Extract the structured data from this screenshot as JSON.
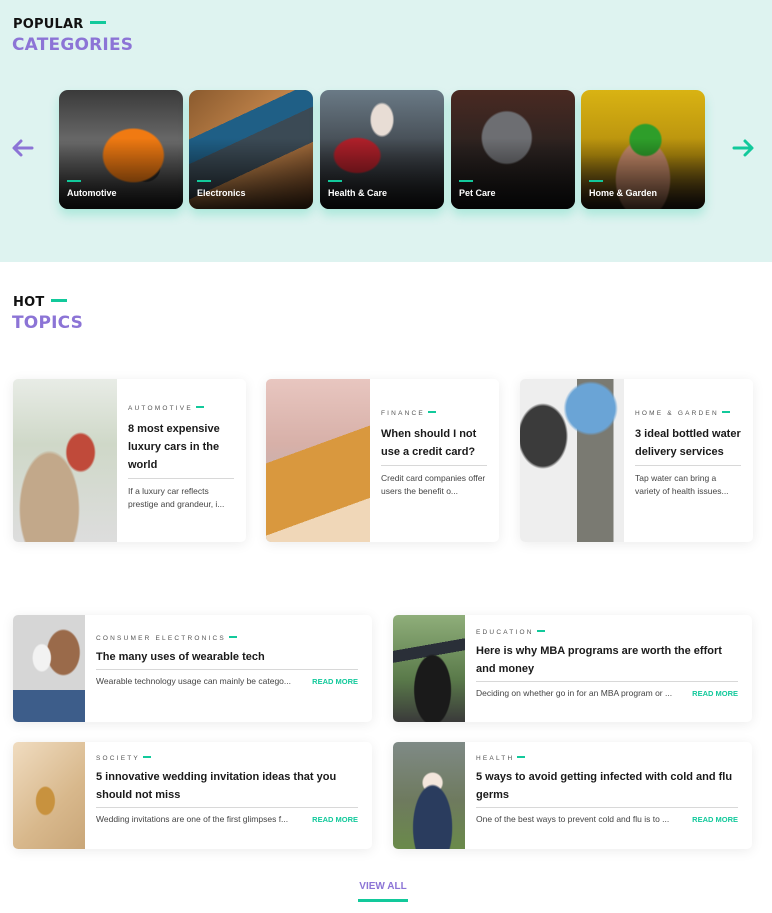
{
  "colors": {
    "accent_green": "#12c99b",
    "accent_purple": "#8c74d6",
    "section_bg": "#def3f0"
  },
  "popular": {
    "kicker": "POPULAR",
    "title": "CATEGORIES",
    "prev_icon": "arrow-left-icon",
    "next_icon": "arrow-right-icon",
    "categories": [
      {
        "label": "Automotive"
      },
      {
        "label": "Electronics"
      },
      {
        "label": "Health & Care"
      },
      {
        "label": "Pet Care"
      },
      {
        "label": "Home & Garden"
      }
    ]
  },
  "hot": {
    "kicker": "HOT",
    "title": "TOPICS",
    "featured": [
      {
        "tag": "AUTOMOTIVE",
        "title": "8 most expensive luxury cars in the world",
        "excerpt": "If a luxury car reflects prestige and grandeur, i..."
      },
      {
        "tag": "FINANCE",
        "title": "When should I not use a credit card?",
        "excerpt": "Credit card companies offer users the benefit o..."
      },
      {
        "tag": "HOME & GARDEN",
        "title": "3 ideal bottled water delivery services",
        "excerpt": "Tap water can bring a variety of health issues..."
      }
    ],
    "list": [
      {
        "tag": "CONSUMER ELECTRONICS",
        "title": "The many uses of wearable tech",
        "excerpt": "Wearable technology usage can mainly be catego...",
        "more": "READ MORE"
      },
      {
        "tag": "EDUCATION",
        "title": "Here is why MBA programs are worth the effort and money",
        "excerpt": "Deciding on whether go in for an MBA program or ...",
        "more": "READ MORE"
      },
      {
        "tag": "SOCIETY",
        "title": "5 innovative wedding invitation ideas that you should not miss",
        "excerpt": "Wedding invitations are one of the first glimpses f...",
        "more": "READ MORE"
      },
      {
        "tag": "HEALTH",
        "title": "5 ways to avoid getting infected with cold and flu germs",
        "excerpt": "One of the best ways to prevent cold and flu is to ...",
        "more": "READ MORE"
      }
    ],
    "view_all": "VIEW ALL"
  }
}
